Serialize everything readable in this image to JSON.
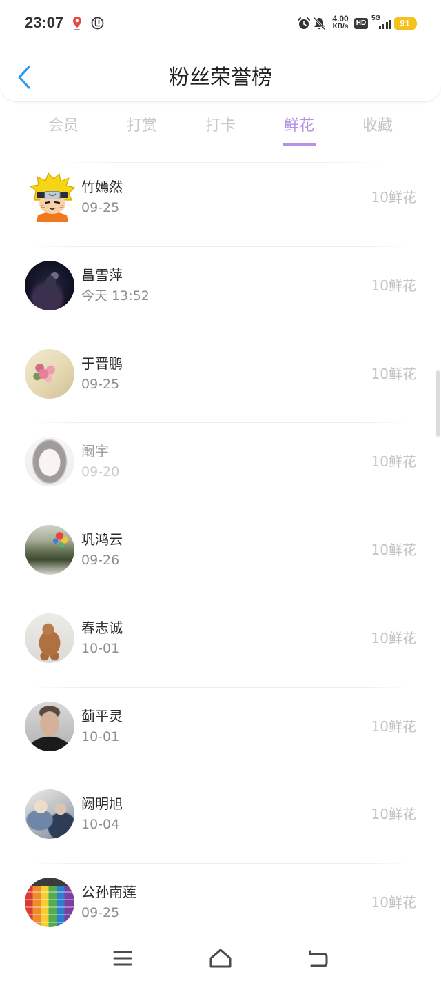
{
  "status_bar": {
    "time": "23:07",
    "net_speed": {
      "value": "4.00",
      "unit": "KB/s"
    },
    "hd_badge": "HD",
    "network_type": "5G",
    "battery_level": "91",
    "icons": [
      "location-pin-icon",
      "app-notification-icon",
      "alarm-icon",
      "bell-off-icon",
      "signal-bars-icon",
      "battery-icon"
    ]
  },
  "header": {
    "back_icon": "chevron-left-icon",
    "title": "粉丝荣誉榜"
  },
  "tabs": [
    {
      "label": "会员",
      "active": false
    },
    {
      "label": "打赏",
      "active": false
    },
    {
      "label": "打卡",
      "active": false
    },
    {
      "label": "鲜花",
      "active": true
    },
    {
      "label": "收藏",
      "active": false
    }
  ],
  "ranking_list": [
    {
      "name": "竹嫣然",
      "date": "09-25",
      "gift": "10鲜花",
      "dimmed": false
    },
    {
      "name": "昌雪萍",
      "date": "今天 13:52",
      "gift": "10鲜花",
      "dimmed": false
    },
    {
      "name": "于晋鹏",
      "date": "09-25",
      "gift": "10鲜花",
      "dimmed": false
    },
    {
      "name": "阚宇",
      "date": "09-20",
      "gift": "10鲜花",
      "dimmed": true
    },
    {
      "name": "巩鸿云",
      "date": "09-26",
      "gift": "10鲜花",
      "dimmed": false
    },
    {
      "name": "春志诚",
      "date": "10-01",
      "gift": "10鲜花",
      "dimmed": false
    },
    {
      "name": "蓟平灵",
      "date": "10-01",
      "gift": "10鲜花",
      "dimmed": false
    },
    {
      "name": "阙明旭",
      "date": "10-04",
      "gift": "10鲜花",
      "dimmed": false
    },
    {
      "name": "公孙南莲",
      "date": "09-25",
      "gift": "10鲜花",
      "dimmed": false
    }
  ],
  "bottom_nav": {
    "icons": [
      "menu-icon",
      "home-icon",
      "back-icon"
    ]
  },
  "theme": {
    "accent": "#b592e6",
    "back_icon": "#2b9af3",
    "battery": "#f5c21b"
  }
}
